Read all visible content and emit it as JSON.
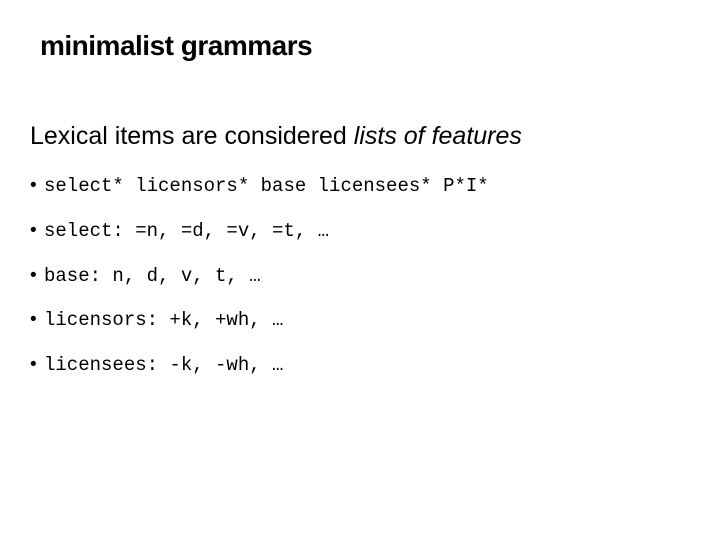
{
  "title": "minimalist grammars",
  "intro_plain": "Lexical items are considered ",
  "intro_italic": "lists of features",
  "bullets": [
    "select* licensors* base licensees* P*I*",
    "select: =n, =d, =v, =t, …",
    "base: n, d, v, t, …",
    "licensors: +k, +wh, …",
    "licensees: -k, -wh, …"
  ]
}
